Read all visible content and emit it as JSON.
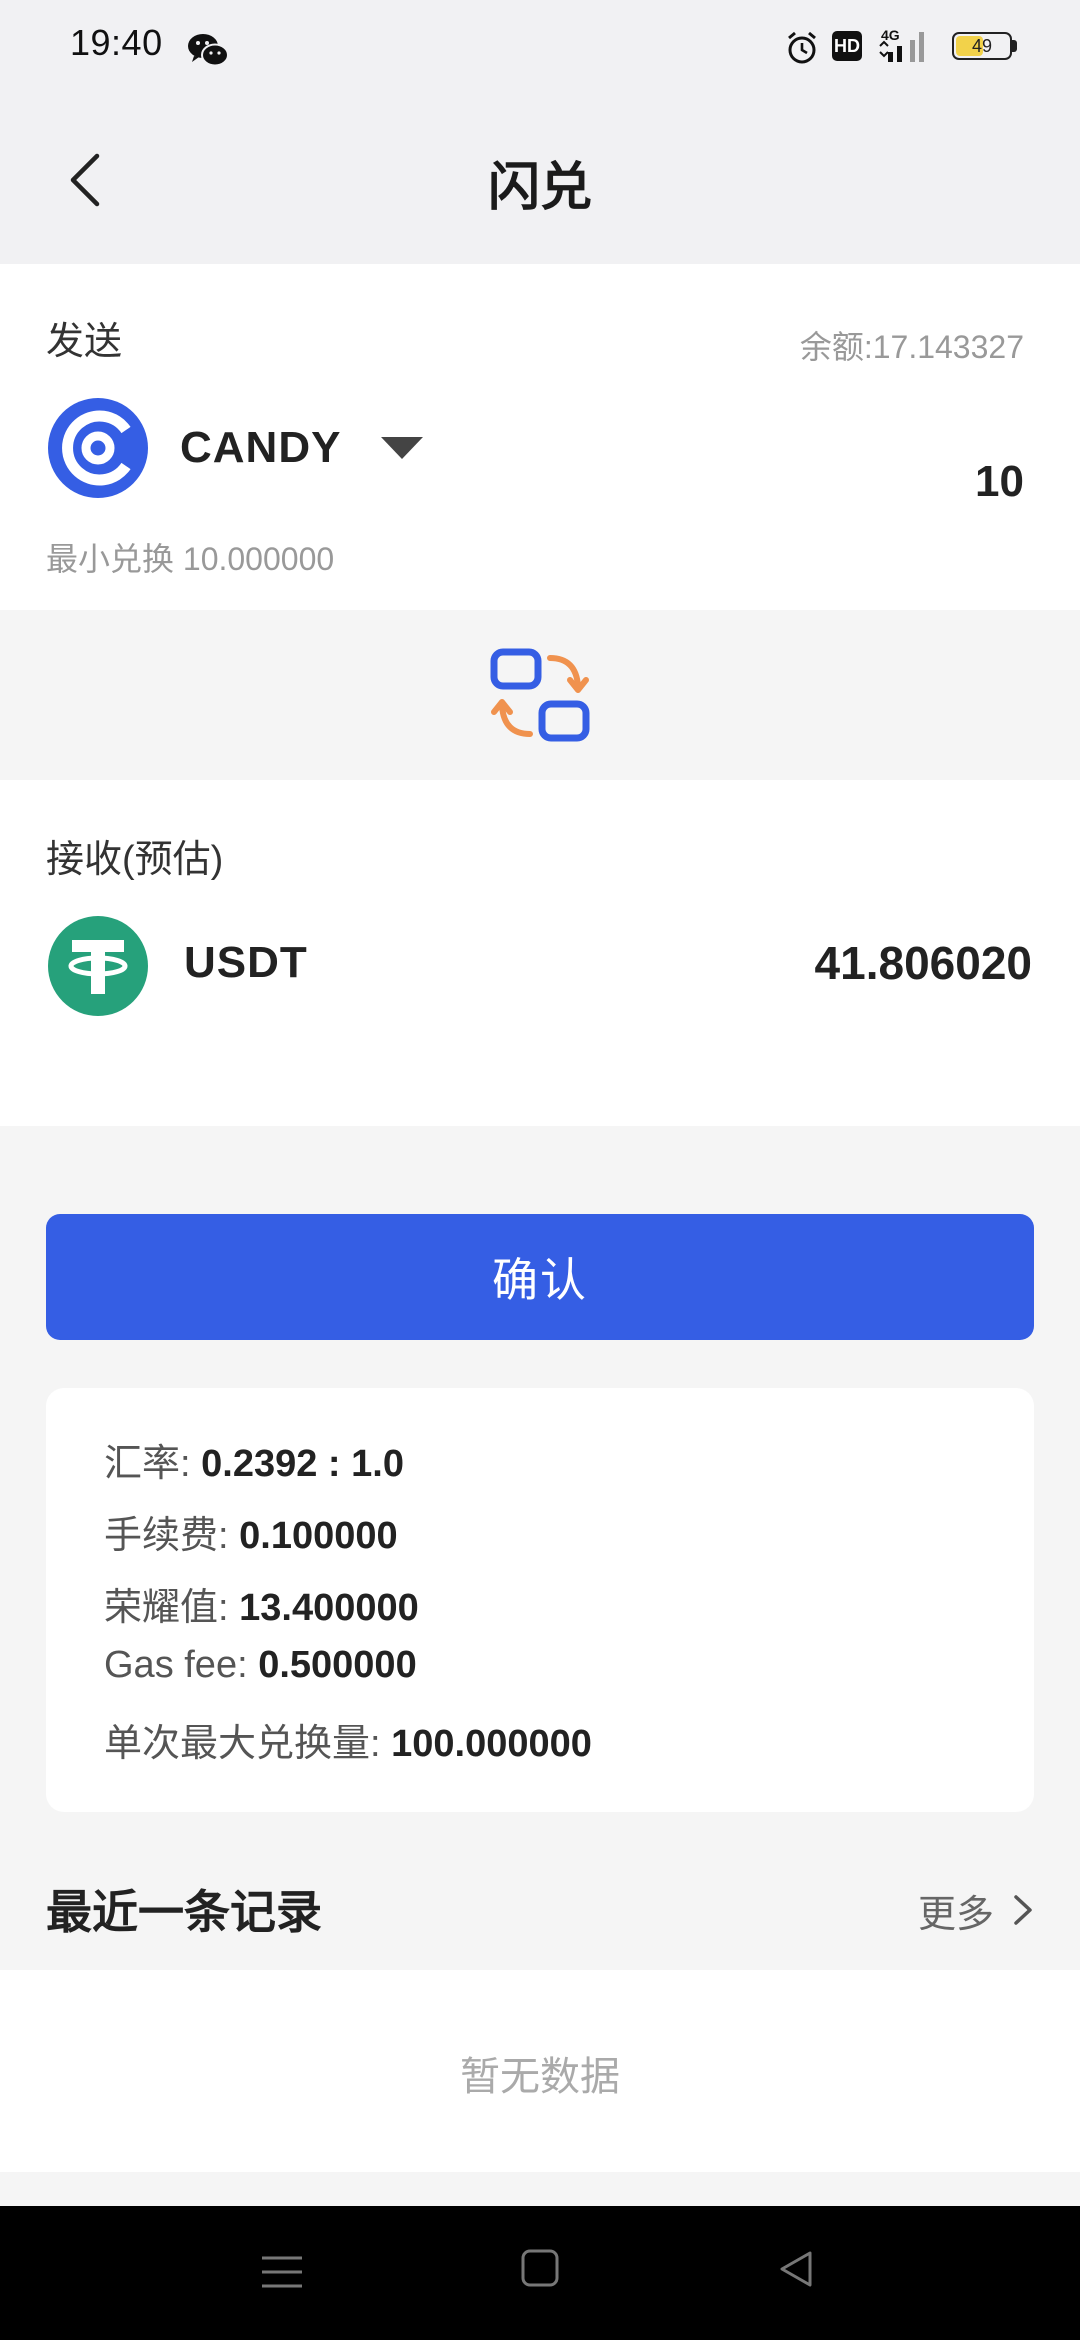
{
  "status_bar": {
    "time": "19:40",
    "hd_label": "HD",
    "network_label": "4G",
    "battery_level": "49"
  },
  "header": {
    "title": "闪兑"
  },
  "send": {
    "label": "发送",
    "balance": "余额:17.143327",
    "token": "CANDY",
    "amount": "10",
    "min_exchange": "最小兑换 10.000000"
  },
  "receive": {
    "label": "接收(预估)",
    "token": "USDT",
    "amount": "41.806020"
  },
  "confirm_label": "确认",
  "details": {
    "rate_label": "汇率: ",
    "rate_value": "0.2392 : 1.0",
    "fee_label": "手续费: ",
    "fee_value": "0.100000",
    "honor_label": "荣耀值: ",
    "honor_value": "13.400000",
    "gas_label": "Gas fee: ",
    "gas_value": "0.500000",
    "max_label": "单次最大兑换量: ",
    "max_value": "100.000000"
  },
  "records": {
    "title": "最近一条记录",
    "more_label": "更多",
    "empty_text": "暂无数据"
  },
  "colors": {
    "primary": "#355ee4",
    "usdt_green": "#26a17b",
    "swap_orange": "#f0924e"
  }
}
